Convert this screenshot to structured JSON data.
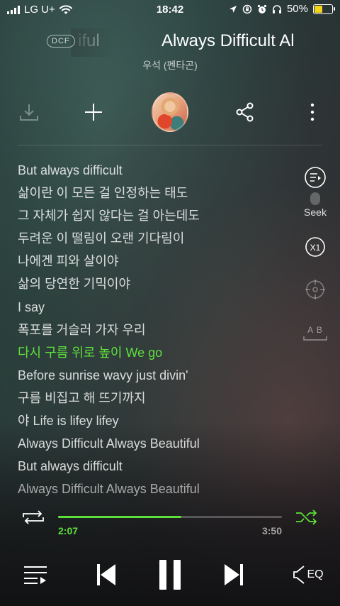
{
  "status_bar": {
    "carrier": "LG U+",
    "time": "18:42",
    "battery": "50%",
    "battery_level": 0.5
  },
  "header": {
    "badge": "DCF",
    "prev_title": "iful",
    "title": "Always Difficult Al",
    "artist": "우석 (펜타곤)"
  },
  "actions": {
    "download_icon": "download-icon",
    "add_icon": "plus-icon",
    "share_icon": "share-icon",
    "more_icon": "more-vertical-icon"
  },
  "lyrics": [
    "But always difficult",
    "삶이란 이 모든 걸 인정하는 태도",
    "그 자체가 쉽지 않다는 걸 아는데도",
    "두려운 이 떨림이 오랜 기다림이",
    "나에겐 피와 살이야",
    "삶의 당연한 기믹이야",
    "I say",
    "폭포를 거슬러 가자 우리",
    "다시 구름 위로 높이 We go",
    "Before sunrise wavy just divin'",
    "구름 비집고 해 뜨기까지",
    "야 Life is lifey lifey",
    "Always Difficult Always Beautiful",
    "But always difficult",
    "Always Difficult Always Beautiful"
  ],
  "active_lyric_index": 8,
  "side_tools": {
    "seek_label": "Seek",
    "speed_label": "X1",
    "translate_label": "A B"
  },
  "player": {
    "current_time": "2:07",
    "total_time": "3:50",
    "progress": 0.552,
    "eq_label": "EQ"
  },
  "colors": {
    "accent": "#5ee03a",
    "battery": "#f2d31b"
  }
}
